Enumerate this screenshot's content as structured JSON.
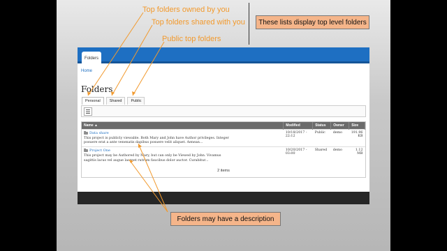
{
  "annotations": {
    "owned": "Top folders owned by you",
    "shared": "Top folders shared with you",
    "public": "Public top folders",
    "top_note": "These lists display top level folders",
    "bottom_note": "Folders may have a description"
  },
  "app": {
    "top_tab": "Folders",
    "breadcrumb": "Home",
    "title": "Folders",
    "tabs": [
      "Personal",
      "Shared",
      "Public"
    ],
    "menu_icon": "menu-icon",
    "table": {
      "headers": {
        "name": "Name ▲",
        "modified": "Modified",
        "status": "Status",
        "owner": "Owner",
        "size": "Size"
      },
      "rows": [
        {
          "name": "Data share",
          "description": "This project is publicly viewable. Both Mary and John have Author privileges. Integer posuere erat a ante venenatis dapibus posuere velit aliquet. Aenean...",
          "modified": "10/18/2017 - 22:12",
          "status": "Public",
          "owner": "demo",
          "size": "191.96 KB"
        },
        {
          "name": "Project One",
          "description": "This project may be Authored by Mary, but can only be Viewed by John. Vivamus sagittis lacus vel augue laoreet rutrum faucibus dolor auctor. Curabitur...",
          "modified": "10/20/2017 - 03:00",
          "status": "Shared",
          "owner": "demo",
          "size": "1.12 MB"
        }
      ],
      "count": "2 items"
    }
  },
  "colors": {
    "annotation": "#f29a2e",
    "note_bg": "#f5b58a",
    "topbar": "#1e6fc2"
  }
}
